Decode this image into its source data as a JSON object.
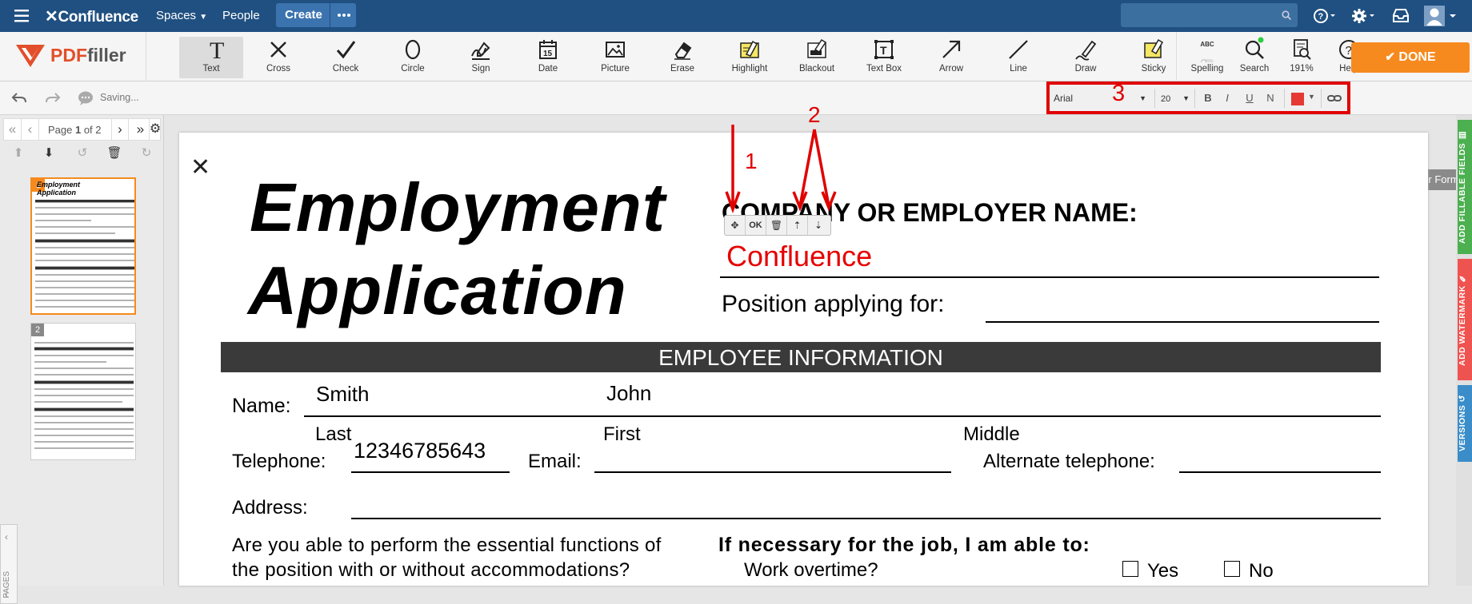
{
  "topnav": {
    "brand": "Confluence",
    "spaces": "Spaces",
    "people": "People",
    "create": "Create"
  },
  "pdffiller": {
    "logo_pdf": "PDF",
    "logo_filler": "filler"
  },
  "tools": [
    {
      "label": "Text",
      "icon": "text-icon"
    },
    {
      "label": "Cross",
      "icon": "cross-icon"
    },
    {
      "label": "Check",
      "icon": "check-icon"
    },
    {
      "label": "Circle",
      "icon": "circle-icon"
    },
    {
      "label": "Sign",
      "icon": "sign-icon"
    },
    {
      "label": "Date",
      "icon": "date-icon"
    },
    {
      "label": "Picture",
      "icon": "picture-icon"
    },
    {
      "label": "Erase",
      "icon": "erase-icon"
    },
    {
      "label": "Highlight",
      "icon": "highlight-icon"
    },
    {
      "label": "Blackout",
      "icon": "blackout-icon"
    },
    {
      "label": "Text Box",
      "icon": "text-box-icon"
    },
    {
      "label": "Arrow",
      "icon": "arrow-icon"
    },
    {
      "label": "Line",
      "icon": "line-icon"
    },
    {
      "label": "Draw",
      "icon": "draw-icon"
    },
    {
      "label": "Sticky",
      "icon": "sticky-icon"
    },
    {
      "label": "Spelling",
      "icon": "spelling-icon",
      "badge": "ABC"
    },
    {
      "label": "Search",
      "icon": "search-icon"
    },
    {
      "label": "191%",
      "icon": "zoom-icon"
    },
    {
      "label": "Help",
      "icon": "help-icon"
    }
  ],
  "done": "DONE",
  "saving": "Saving...",
  "format": {
    "font": "Arial",
    "size": "20",
    "bold": "B",
    "italic": "I",
    "underline": "U",
    "normal": "N",
    "color": "#e53935"
  },
  "find_another": "Find Another Form",
  "pages": {
    "page_prefix": "Page ",
    "current": "1",
    "of_label": " of 2",
    "tab_label": "PAGES",
    "thumb1": "1",
    "thumb2": "2",
    "thumb1_title_a": "Employment",
    "thumb1_title_b": "Application"
  },
  "side_tabs": {
    "fillable": "ADD FILLABLE FIELDS",
    "watermark": "ADD WATERMARK",
    "versions": "VERSIONS"
  },
  "annotations": {
    "a1": "1",
    "a2": "2",
    "a3": "3"
  },
  "ctx": {
    "ok": "OK"
  },
  "form": {
    "title1": "Employment",
    "title2": "Application",
    "company_label": "COMPANY OR EMPLOYER NAME:",
    "company_value": "Confluence",
    "position_label": "Position applying for:",
    "section": "EMPLOYEE INFORMATION",
    "name_label": "Name:",
    "last_value": "Smith",
    "first_value": "John",
    "last_label": "Last",
    "first_label": "First",
    "middle_label": "Middle",
    "phone_label": "Telephone:",
    "phone_value": "12346785643",
    "email_label": "Email:",
    "alt_label": "Alternate telephone:",
    "address_label": "Address:",
    "question1": "Are you able to perform the essential functions of",
    "question2": "the position with or without accommodations?",
    "able_heading": "If necessary for the job, I am able to:",
    "overtime": "Work overtime?",
    "yes": "Yes",
    "no": "No"
  }
}
